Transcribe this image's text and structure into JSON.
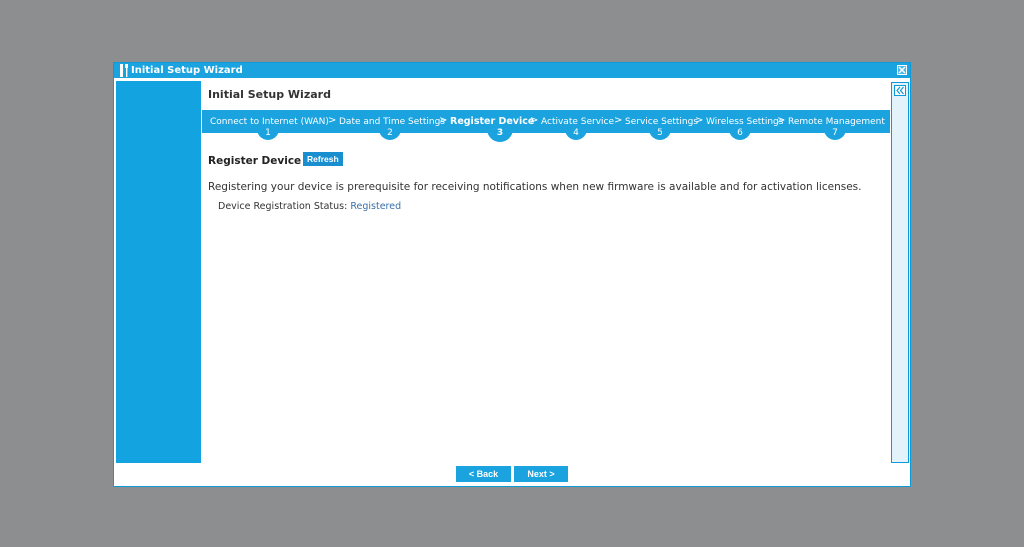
{
  "window": {
    "title": "Initial Setup Wizard",
    "title_icon": "wrench-screwdriver-icon",
    "close_icon": "close-icon"
  },
  "wizard": {
    "heading": "Initial Setup Wizard",
    "collapse_icon": "double-chevron-left-icon",
    "separator": ">",
    "steps": [
      {
        "label": "Connect to Internet (WAN)",
        "number": "1"
      },
      {
        "label": "Date and Time Settings",
        "number": "2"
      },
      {
        "label": "Register Device",
        "number": "3"
      },
      {
        "label": "Activate Service",
        "number": "4"
      },
      {
        "label": "Service Settings",
        "number": "5"
      },
      {
        "label": "Wireless Settings",
        "number": "6"
      },
      {
        "label": "Remote Management",
        "number": "7"
      }
    ],
    "active_step": 3
  },
  "register": {
    "title": "Register Device",
    "refresh_label": "Refresh",
    "description": "Registering your device is prerequisite for receiving notifications when new firmware is available and for activation licenses.",
    "status_label": "Device Registration Status:",
    "status_value": "Registered"
  },
  "nav": {
    "back_label": "< Back",
    "next_label": "Next >"
  },
  "colors": {
    "accent": "#1aa3df",
    "sidebar": "#12a3e0",
    "status_link": "#3a6fa8",
    "background": "#8c8e90"
  }
}
